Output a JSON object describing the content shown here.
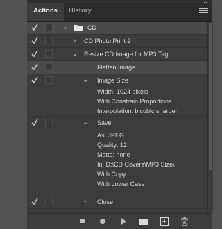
{
  "tabs": [
    {
      "label": "Actions"
    },
    {
      "label": "History"
    }
  ],
  "panel_menu": {
    "icon": "hamburger-menu-icon"
  },
  "rows": [
    {
      "label": "CD",
      "checked": true,
      "expanded": true
    },
    {
      "label": "CD Photo Print 2",
      "checked": true,
      "expanded": false
    },
    {
      "label": "Resize CD Image for MP3 Tag",
      "checked": true,
      "expanded": true
    },
    {
      "label": "Flatten Image",
      "checked": true
    },
    {
      "label": "Image Size",
      "checked": true,
      "expanded": true,
      "details": [
        "Width: 1024 pixels",
        "With Constrain Proportions",
        "Interpolation: bicubic sharper"
      ]
    },
    {
      "label": "Save",
      "checked": true,
      "expanded": true,
      "details": [
        "As: JPEG",
        "Quality: 12",
        "Matte: none",
        "In: D:\\CD Covers\\MP3 Size\\",
        "With Copy",
        "With Lower Case"
      ]
    },
    {
      "label": "Close",
      "checked": true,
      "expanded": false
    }
  ],
  "toolbar": {
    "buttons": [
      "stop-icon",
      "record-icon",
      "play-icon",
      "folder-icon",
      "new-action-icon",
      "trash-icon"
    ]
  },
  "colors": {
    "panel_bg": "#3c3c3c",
    "selected_row_bg": "#4a4a4a",
    "text": "#d6d6d6"
  }
}
